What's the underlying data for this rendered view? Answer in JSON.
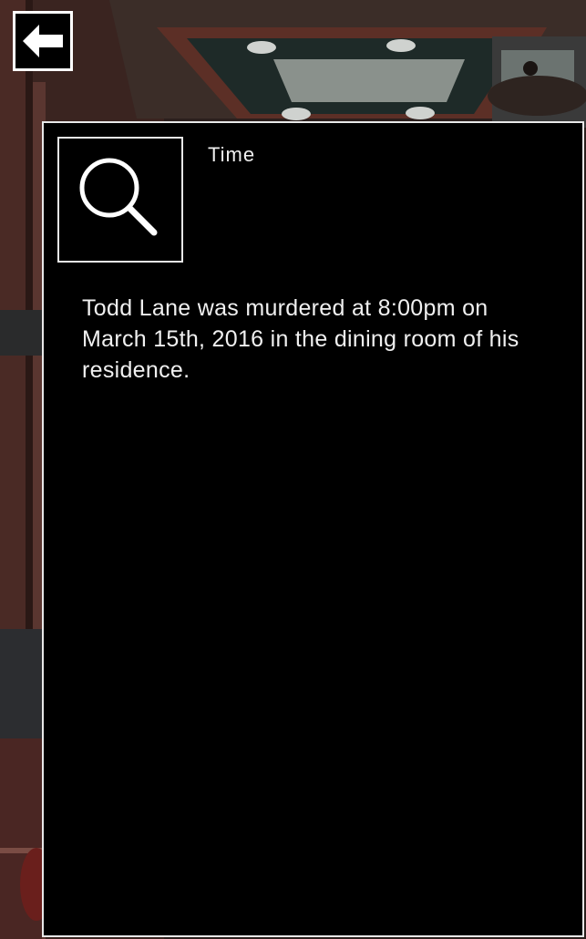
{
  "back_button": {
    "icon": "left-arrow-icon"
  },
  "clue": {
    "icon": "magnifying-glass-icon",
    "title": "Time",
    "description": "Todd Lane was murdered at 8:00pm on March 15th, 2016 in the dining room of his residence."
  },
  "colors": {
    "panel_background": "#000000",
    "panel_border": "#e8e8e8",
    "text": "#f0f0f0"
  }
}
